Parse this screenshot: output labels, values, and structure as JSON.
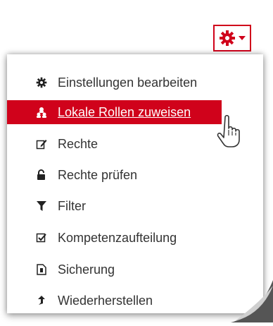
{
  "trigger": {
    "icon": "gear-icon",
    "caret_icon": "caret-down-icon",
    "accent": "#d0021b"
  },
  "menu": {
    "items": [
      {
        "label": "Einstellungen bearbeiten",
        "icon": "gear-icon"
      },
      {
        "label": "Lokale Rollen zuweisen",
        "icon": "users-icon",
        "active": true
      },
      {
        "label": "Rechte",
        "icon": "edit-icon"
      },
      {
        "label": "Rechte prüfen",
        "icon": "unlock-icon"
      },
      {
        "label": "Filter",
        "icon": "filter-icon"
      },
      {
        "label": "Kompetenzaufteilung",
        "icon": "checkbox-icon"
      },
      {
        "label": "Sicherung",
        "icon": "file-icon"
      },
      {
        "label": "Wiederherstellen",
        "icon": "restore-arrow-icon"
      }
    ]
  },
  "cursor": {
    "icon": "hand-pointer-icon"
  }
}
